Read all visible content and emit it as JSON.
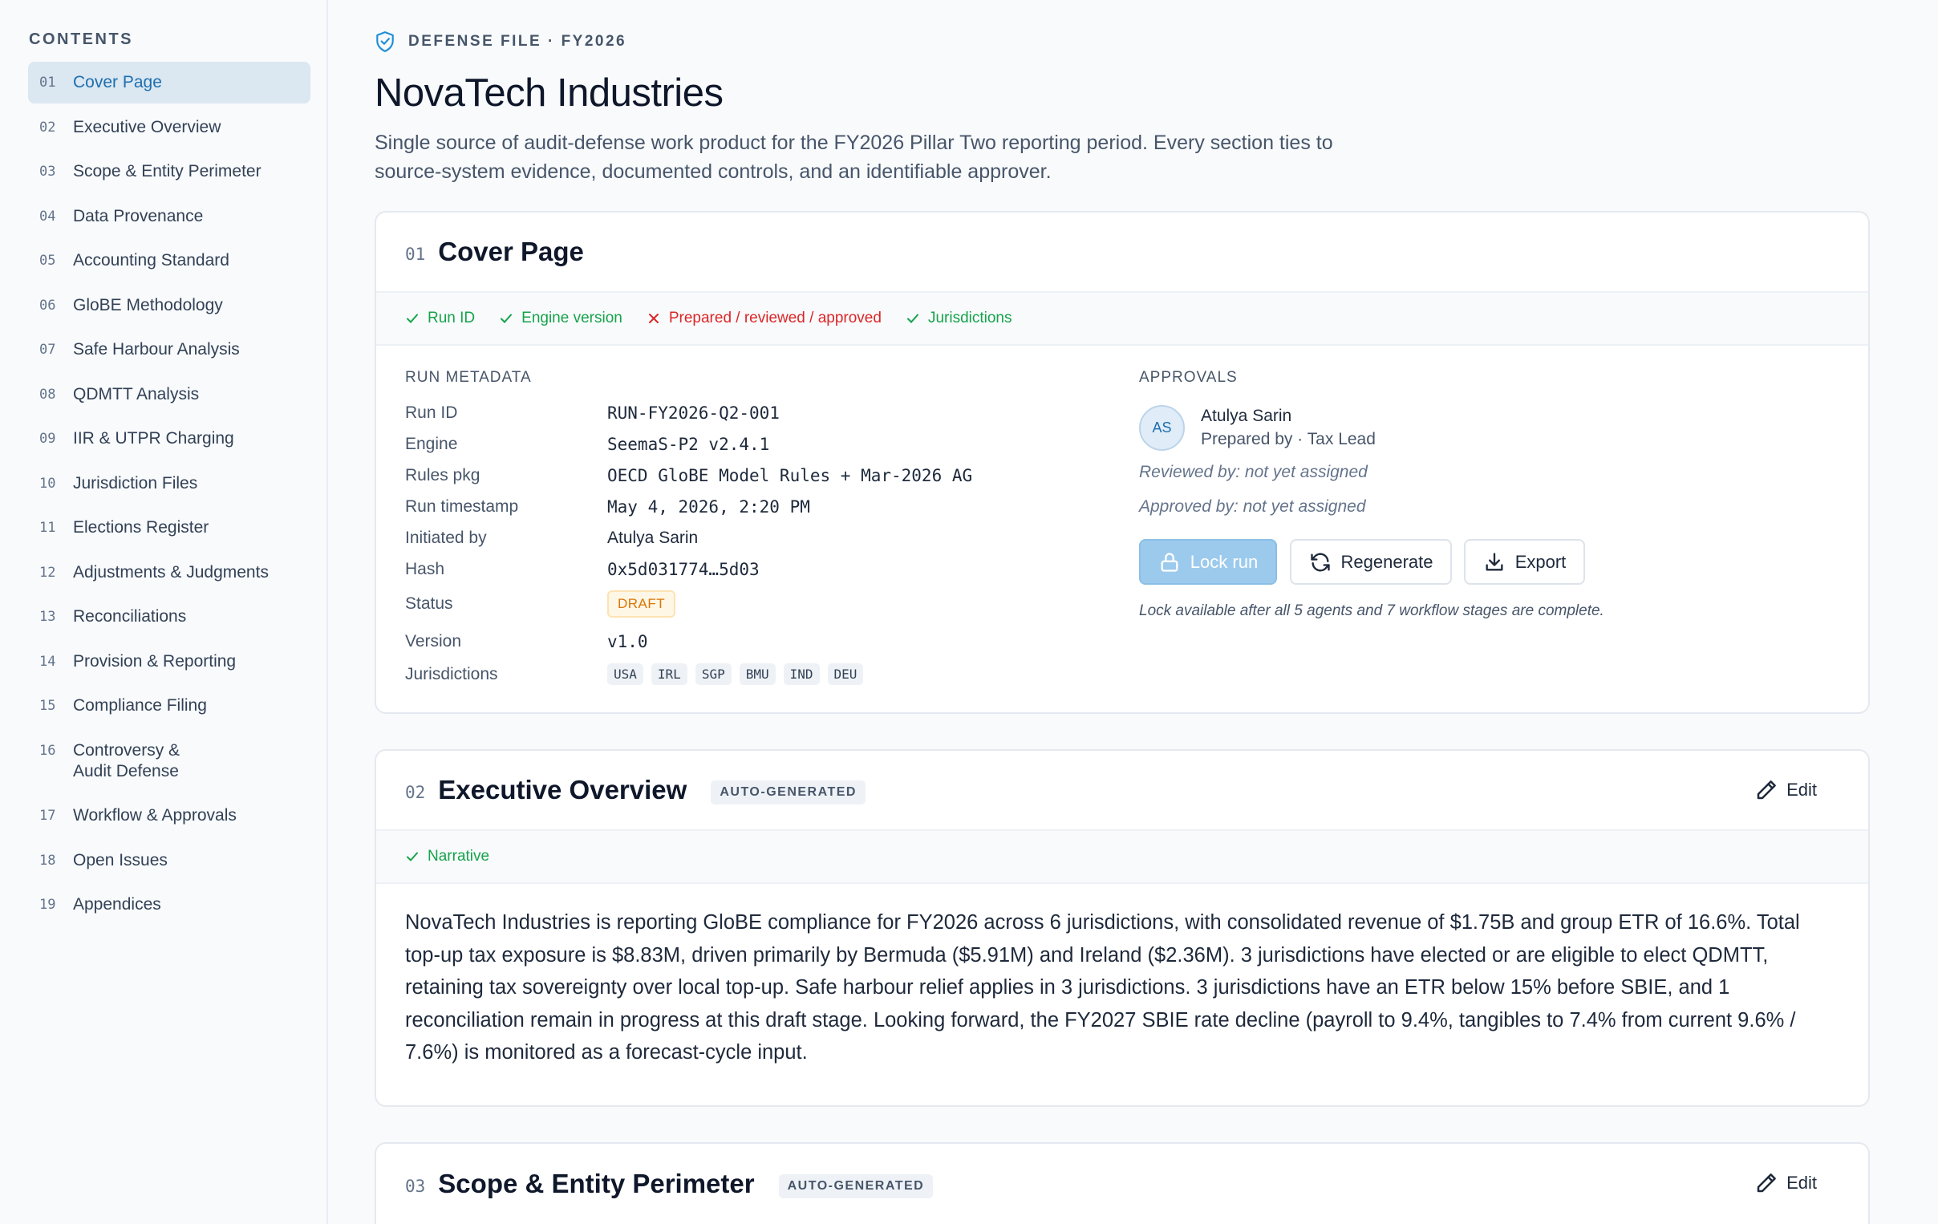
{
  "sidebar": {
    "title": "CONTENTS",
    "items": [
      {
        "num": "01",
        "label": "Cover Page"
      },
      {
        "num": "02",
        "label": "Executive Overview"
      },
      {
        "num": "03",
        "label": "Scope & Entity Perimeter"
      },
      {
        "num": "04",
        "label": "Data Provenance"
      },
      {
        "num": "05",
        "label": "Accounting Standard"
      },
      {
        "num": "06",
        "label": "GloBE Methodology"
      },
      {
        "num": "07",
        "label": "Safe Harbour Analysis"
      },
      {
        "num": "08",
        "label": "QDMTT Analysis"
      },
      {
        "num": "09",
        "label": "IIR & UTPR Charging"
      },
      {
        "num": "10",
        "label": "Jurisdiction Files"
      },
      {
        "num": "11",
        "label": "Elections Register"
      },
      {
        "num": "12",
        "label": "Adjustments & Judgments"
      },
      {
        "num": "13",
        "label": "Reconciliations"
      },
      {
        "num": "14",
        "label": "Provision & Reporting"
      },
      {
        "num": "15",
        "label": "Compliance Filing"
      },
      {
        "num": "16",
        "label": "Controversy & Audit Defense"
      },
      {
        "num": "17",
        "label": "Workflow & Approvals"
      },
      {
        "num": "18",
        "label": "Open Issues"
      },
      {
        "num": "19",
        "label": "Appendices"
      }
    ]
  },
  "header": {
    "eyebrow": "DEFENSE FILE · FY2026",
    "title": "NovaTech Industries",
    "description": "Single source of audit-defense work product for the FY2026 Pillar Two reporting period. Every section ties to source-system evidence, documented controls, and an identifiable approver."
  },
  "cover": {
    "num": "01",
    "title": "Cover Page",
    "checks": [
      {
        "label": "Run ID",
        "ok": true
      },
      {
        "label": "Engine version",
        "ok": true
      },
      {
        "label": "Prepared / reviewed / approved",
        "ok": false
      },
      {
        "label": "Jurisdictions",
        "ok": true
      }
    ],
    "meta_heading": "RUN METADATA",
    "meta": {
      "run_id_key": "Run ID",
      "run_id": "RUN-FY2026-Q2-001",
      "engine_key": "Engine",
      "engine": "SeemaS-P2 v2.4.1",
      "rules_key": "Rules pkg",
      "rules": "OECD GloBE Model Rules + Mar-2026 AG",
      "timestamp_key": "Run timestamp",
      "timestamp": "May 4, 2026, 2:20 PM",
      "initiated_key": "Initiated by",
      "initiated": "Atulya Sarin",
      "hash_key": "Hash",
      "hash": "0x5d031774…5d03",
      "status_key": "Status",
      "status": "DRAFT",
      "version_key": "Version",
      "version": "v1.0",
      "jurisdictions_key": "Jurisdictions",
      "jurisdictions": [
        "USA",
        "IRL",
        "SGP",
        "BMU",
        "IND",
        "DEU"
      ]
    },
    "approvals_heading": "APPROVALS",
    "approver": {
      "initials": "AS",
      "name": "Atulya Sarin",
      "role": "Prepared by · Tax Lead"
    },
    "reviewed": "Reviewed by: not yet assigned",
    "approved": "Approved by: not yet assigned",
    "buttons": {
      "lock": "Lock run",
      "regenerate": "Regenerate",
      "export": "Export"
    },
    "lock_note": "Lock available after all 5 agents and 7 workflow stages are complete."
  },
  "overview": {
    "num": "02",
    "title": "Executive Overview",
    "badge": "AUTO-GENERATED",
    "edit": "Edit",
    "check": "Narrative",
    "text": "NovaTech Industries is reporting GloBE compliance for FY2026 across 6 jurisdictions, with consolidated revenue of $1.75B and group ETR of 16.6%. Total top-up tax exposure is $8.83M, driven primarily by Bermuda ($5.91M) and Ireland ($2.36M). 3 jurisdictions have elected or are eligible to elect QDMTT, retaining tax sovereignty over local top-up. Safe harbour relief applies in 3 jurisdictions. 3 jurisdictions have an ETR below 15% before SBIE, and 1 reconciliation remain in progress at this draft stage. Looking forward, the FY2027 SBIE rate decline (payroll to 9.4%, tangibles to 7.4% from current 9.6% / 7.6%) is monitored as a forecast-cycle input."
  },
  "scope": {
    "num": "03",
    "title": "Scope & Entity Perimeter",
    "badge": "AUTO-GENERATED",
    "edit": "Edit"
  },
  "colors": {
    "accent": "#1d6fb0",
    "ok": "#16a34a",
    "error": "#dc2626",
    "draft": "#d97706"
  }
}
